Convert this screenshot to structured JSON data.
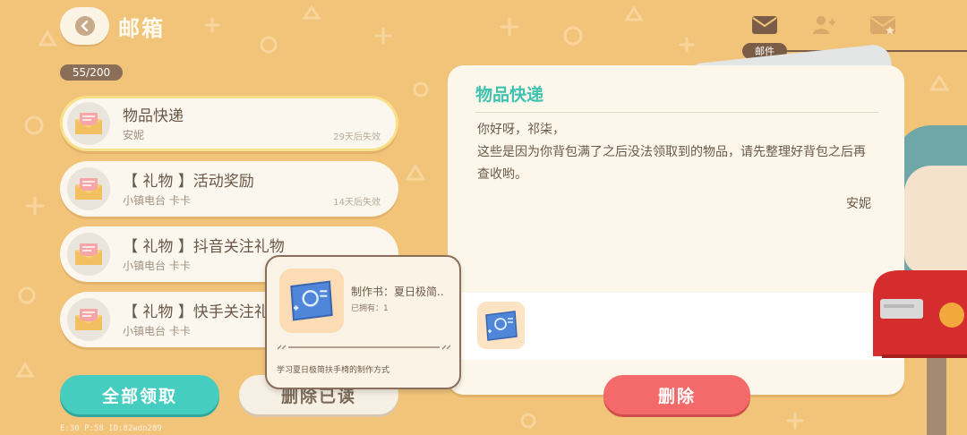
{
  "header": {
    "title": "邮箱",
    "back_icon": "chevron-left-icon"
  },
  "tabs": [
    {
      "icon": "envelope-icon",
      "label": "邮件",
      "active": true
    },
    {
      "icon": "add-friend-icon",
      "active": false
    },
    {
      "icon": "starred-envelope-icon",
      "active": false
    }
  ],
  "mail_count": "55/200",
  "mails": [
    {
      "title": "物品快递",
      "sender": "安妮",
      "expire": "29天后失效",
      "selected": true
    },
    {
      "title": "【 礼物 】活动奖励",
      "sender": "小镇电台 卡卡",
      "expire": "14天后失效"
    },
    {
      "title": "【 礼物 】抖音关注礼物",
      "sender": "小镇电台 卡卡",
      "expire": ""
    },
    {
      "title": "【 礼物 】快手关注礼",
      "sender": "小镇电台 卡卡",
      "expire": ""
    }
  ],
  "buttons": {
    "claim_all": "全部领取",
    "delete_read": "删除已读",
    "delete": "删除"
  },
  "detail": {
    "title": "物品快递",
    "greeting": "你好呀，祁柒，",
    "body": "这些是因为你背包满了之后没法领取到的物品，请先整理好背包之后再查收哟。",
    "signature": "安妮",
    "attachment_icon": "blueprint-icon"
  },
  "tooltip": {
    "name": "制作书：夏日极简..",
    "owned": "已拥有：1",
    "description": "学习夏日极简扶手椅的制作方式",
    "icon": "blueprint-icon"
  },
  "debug_text": "E:30 P:58 ID:82wdn289",
  "colors": {
    "background": "#f2c47a",
    "accent_teal": "#45cdc0",
    "danger_red": "#f46a6a",
    "brown": "#7b5d47"
  }
}
